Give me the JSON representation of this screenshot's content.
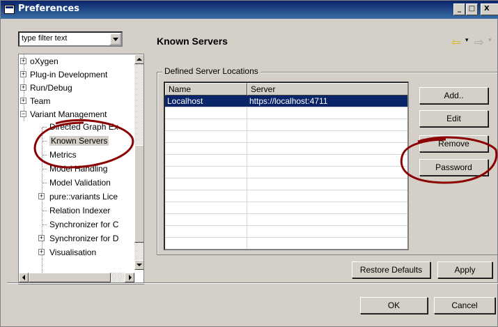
{
  "window": {
    "title": "Preferences",
    "controls": {
      "minimize": "_",
      "maximize": "□",
      "close": "X"
    }
  },
  "filter": {
    "value": "type filter text"
  },
  "tree": {
    "items": [
      {
        "label": "oXygen",
        "expandable": true,
        "expanded": false,
        "level": 0
      },
      {
        "label": "Plug-in Development",
        "expandable": true,
        "expanded": false,
        "level": 0
      },
      {
        "label": "Run/Debug",
        "expandable": true,
        "expanded": false,
        "level": 0
      },
      {
        "label": "Team",
        "expandable": true,
        "expanded": false,
        "level": 0
      },
      {
        "label": "Variant Management",
        "expandable": true,
        "expanded": true,
        "level": 0
      },
      {
        "label": "Directed Graph Ex",
        "expandable": false,
        "level": 1
      },
      {
        "label": "Known Servers",
        "expandable": false,
        "level": 1,
        "selected": true
      },
      {
        "label": "Metrics",
        "expandable": false,
        "level": 1
      },
      {
        "label": "Model Handling",
        "expandable": false,
        "level": 1
      },
      {
        "label": "Model Validation",
        "expandable": false,
        "level": 1
      },
      {
        "label": "pure::variants Lice",
        "expandable": true,
        "expanded": false,
        "level": 1
      },
      {
        "label": "Relation Indexer",
        "expandable": false,
        "level": 1
      },
      {
        "label": "Synchronizer for C",
        "expandable": false,
        "level": 1
      },
      {
        "label": "Synchronizer for D",
        "expandable": true,
        "expanded": false,
        "level": 1
      },
      {
        "label": "Visualisation",
        "expandable": true,
        "expanded": false,
        "level": 1
      }
    ]
  },
  "page": {
    "title": "Known Servers",
    "group_label": "Defined Server Locations",
    "table": {
      "columns": [
        "Name",
        "Server"
      ],
      "rows": [
        {
          "name": "Localhost",
          "server": "https://localhost:4711",
          "selected": true
        }
      ]
    },
    "buttons": {
      "add": "Add..",
      "edit": "Edit",
      "remove": "Remove",
      "password": "Password",
      "restore_defaults": "Restore Defaults",
      "apply": "Apply"
    }
  },
  "footer": {
    "ok": "OK",
    "cancel": "Cancel"
  },
  "colors": {
    "titlebar": "#0a246a",
    "selection": "#0a246a",
    "annotation": "#8b0000",
    "dialog_bg": "#d4d0c8"
  }
}
